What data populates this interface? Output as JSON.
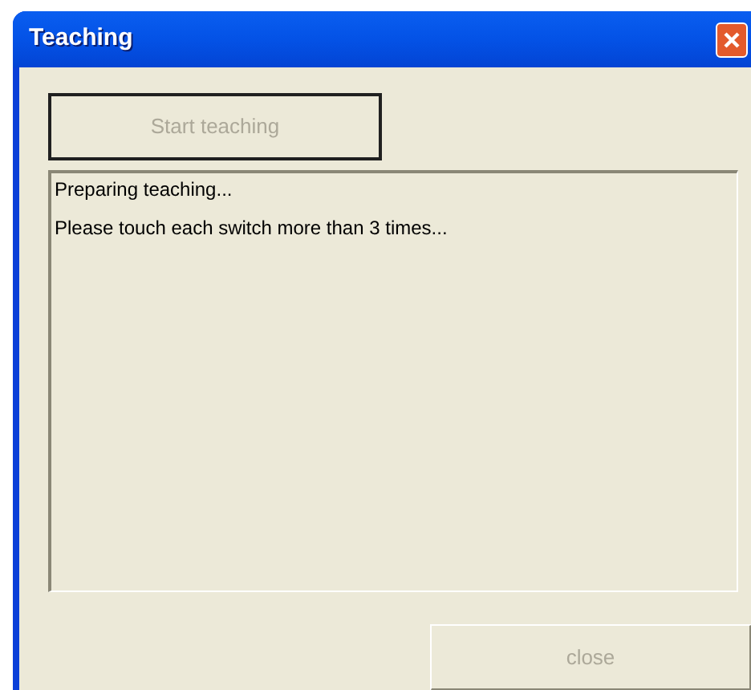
{
  "window": {
    "title": "Teaching"
  },
  "start_button": {
    "label": "Start teaching",
    "disabled": true,
    "default": true
  },
  "log": [
    "Preparing teaching...",
    "Please touch each switch more than 3 times..."
  ],
  "close_button": {
    "label": "close",
    "disabled": true
  }
}
